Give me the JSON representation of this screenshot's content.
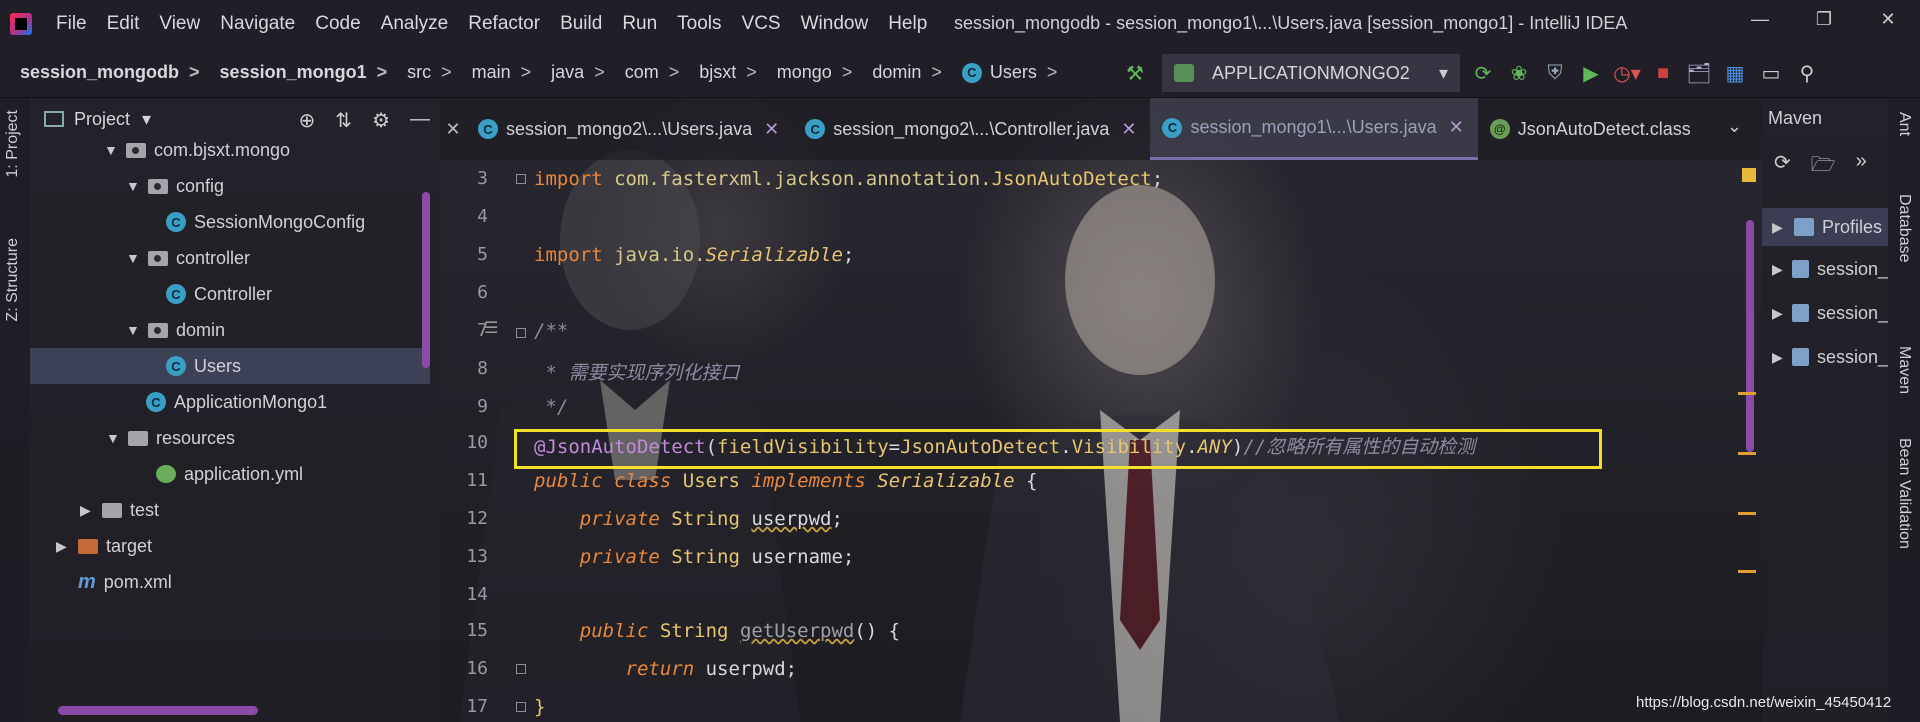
{
  "menu": [
    "File",
    "Edit",
    "View",
    "Navigate",
    "Code",
    "Analyze",
    "Refactor",
    "Build",
    "Run",
    "Tools",
    "VCS",
    "Window",
    "Help"
  ],
  "window_title": "session_mongodb - session_mongo1\\...\\Users.java [session_mongo1] - IntelliJ IDEA",
  "breadcrumbs": [
    "session_mongodb",
    "session_mongo1",
    "src",
    "main",
    "java",
    "com",
    "bjsxt",
    "mongo",
    "domin",
    "Users"
  ],
  "run_config": "APPLICATIONMONGO2",
  "left_tabs": {
    "project": "1: Project",
    "structure": "Z: Structure"
  },
  "project_panel": {
    "title": "Project",
    "tree": [
      {
        "label": "com.bjsxt.mongo"
      },
      {
        "label": "config"
      },
      {
        "label": "SessionMongoConfig"
      },
      {
        "label": "controller"
      },
      {
        "label": "Controller"
      },
      {
        "label": "domin"
      },
      {
        "label": "Users"
      },
      {
        "label": "ApplicationMongo1"
      },
      {
        "label": "resources"
      },
      {
        "label": "application.yml"
      },
      {
        "label": "test"
      },
      {
        "label": "target"
      },
      {
        "label": "pom.xml"
      }
    ]
  },
  "tabs": [
    {
      "label": "session_mongo2\\...\\Users.java"
    },
    {
      "label": "session_mongo2\\...\\Controller.java"
    },
    {
      "label": "session_mongo1\\...\\Users.java"
    },
    {
      "label": "JsonAutoDetect.class"
    }
  ],
  "editor": {
    "line_numbers": [
      "3",
      "4",
      "5",
      "6",
      "7",
      "8",
      "9",
      "10",
      "11",
      "12",
      "13",
      "14",
      "15",
      "16",
      "17"
    ],
    "l3_kw": "import",
    "l3_pkg": "com.fasterxml.jackson.annotation.",
    "l3_cls": "JsonAutoDetect",
    "l3_end": ";",
    "l5_kw": "import",
    "l5_pkg": "java.io.",
    "l5_cls": "Serializable",
    "l5_end": ";",
    "l7": "/**",
    "l8": " * 需要实现序列化接口",
    "l9": " */",
    "l10_ann": "@JsonAutoDetect",
    "l10_p1": "(",
    "l10_field": "fieldVisibility",
    "l10_eq": "=",
    "l10_cls": "JsonAutoDetect",
    "l10_dot1": ".",
    "l10_vis": "Visibility",
    "l10_dot2": ".",
    "l10_any": "ANY",
    "l10_p2": ")",
    "l10_comment": "//忽略所有属性的自动检测",
    "l11_kw1": "public",
    "l11_kw2": "class",
    "l11_name": "Users",
    "l11_kw3": "implements",
    "l11_iface": "Serializable",
    "l11_brace": "{",
    "l12_kw": "private",
    "l12_type": "String",
    "l12_name": "userpwd",
    "l12_end": ";",
    "l13_kw": "private",
    "l13_type": "String",
    "l13_name": "username",
    "l13_end": ";",
    "l15_kw": "public",
    "l15_type": "String",
    "l15_method": "getUserpwd",
    "l15_rest": "() {",
    "l16_kw": "return",
    "l16_rest": "userpwd;",
    "l17": "}"
  },
  "maven_panel": {
    "title": "Maven",
    "rows": [
      "Profiles",
      "session_",
      "session_",
      "session_"
    ]
  },
  "right_tabs": [
    "Ant",
    "Database",
    "Maven",
    "Bean Validation"
  ],
  "watermark": "https://blog.csdn.net/weixin_45450412",
  "colors": {
    "highlight": "#f2e12a",
    "accent": "#8a4aa8",
    "keyword": "#e8873a"
  }
}
